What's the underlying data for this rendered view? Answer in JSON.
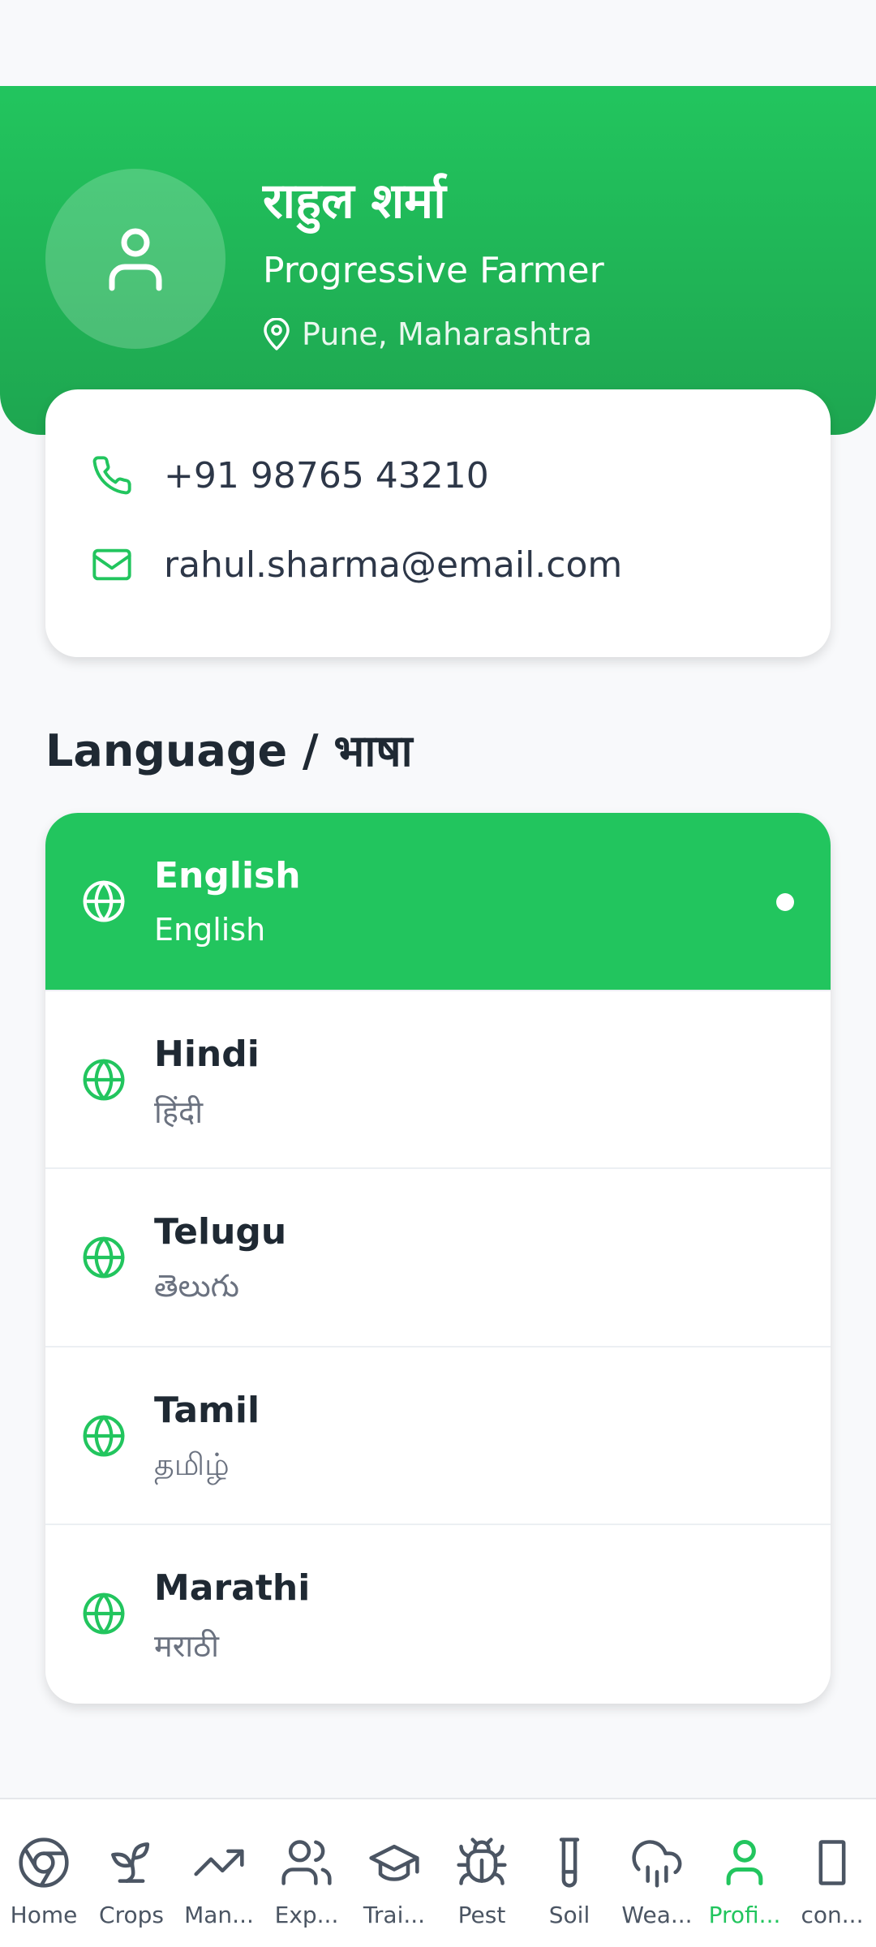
{
  "profile": {
    "name": "राहुल शर्मा",
    "role": "Progressive Farmer",
    "location": "Pune, Maharashtra",
    "avatar_icon": "user-icon",
    "location_icon": "map-pin-icon"
  },
  "contact": {
    "phone": "+91 98765 43210",
    "email": "rahul.sharma@email.com",
    "phone_icon": "phone-icon",
    "email_icon": "mail-icon"
  },
  "language_section": {
    "title": "Language / भाषा",
    "items": [
      {
        "name": "English",
        "native": "English",
        "selected": true
      },
      {
        "name": "Hindi",
        "native": "हिंदी",
        "selected": false
      },
      {
        "name": "Telugu",
        "native": "తెలుగు",
        "selected": false
      },
      {
        "name": "Tamil",
        "native": "தமிழ்",
        "selected": false
      },
      {
        "name": "Marathi",
        "native": "मराठी",
        "selected": false
      }
    ],
    "item_icon": "globe-icon"
  },
  "bottom_nav": {
    "items": [
      {
        "label": "Home",
        "icon": "chrome-icon"
      },
      {
        "label": "Crops",
        "icon": "sprout-icon"
      },
      {
        "label": "Man...",
        "icon": "trending-up-icon"
      },
      {
        "label": "Exp...",
        "icon": "users-icon"
      },
      {
        "label": "Trai...",
        "icon": "graduation-cap-icon"
      },
      {
        "label": "Pest",
        "icon": "bug-icon"
      },
      {
        "label": "Soil",
        "icon": "test-tube-icon"
      },
      {
        "label": "Wea...",
        "icon": "cloud-rain-icon"
      },
      {
        "label": "Profi...",
        "icon": "user-icon",
        "active": true
      },
      {
        "label": "con...",
        "icon": "square-icon"
      }
    ]
  },
  "colors": {
    "brand_green": "#22c55e",
    "background": "#f8f9fb",
    "text_dark": "#1f2933",
    "text_muted": "#6b7280"
  }
}
